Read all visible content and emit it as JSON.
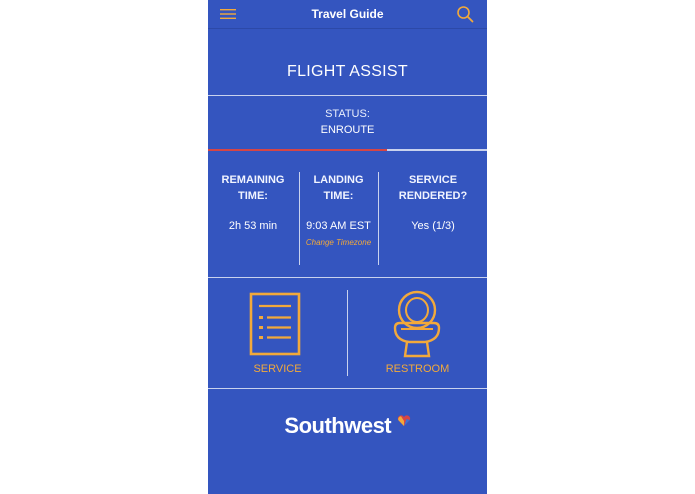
{
  "header": {
    "title": "Travel Guide",
    "menu_icon": "hamburger-menu-icon",
    "search_icon": "search-icon"
  },
  "main": {
    "section_title": "FLIGHT ASSIST",
    "status": {
      "label": "STATUS:",
      "value": "ENROUTE",
      "progress_fraction": 0.64
    },
    "info": {
      "remaining": {
        "label_line1": "REMAINING",
        "label_line2": "TIME:",
        "value": "2h 53 min"
      },
      "landing": {
        "label_line1": "LANDING",
        "label_line2": "TIME:",
        "value": "9:03 AM EST",
        "link": "Change Timezone"
      },
      "service": {
        "label_line1": "SERVICE",
        "label_line2": "RENDERED?",
        "value": "Yes (1/3)"
      }
    },
    "actions": [
      {
        "label": "SERVICE",
        "icon": "document-list-icon"
      },
      {
        "label": "RESTROOM",
        "icon": "toilet-icon"
      }
    ],
    "brand": "Southwest"
  },
  "colors": {
    "background": "#3455bf",
    "accent": "#f2a93b",
    "progress": "#d64545",
    "divider": "#c9d2ee"
  }
}
